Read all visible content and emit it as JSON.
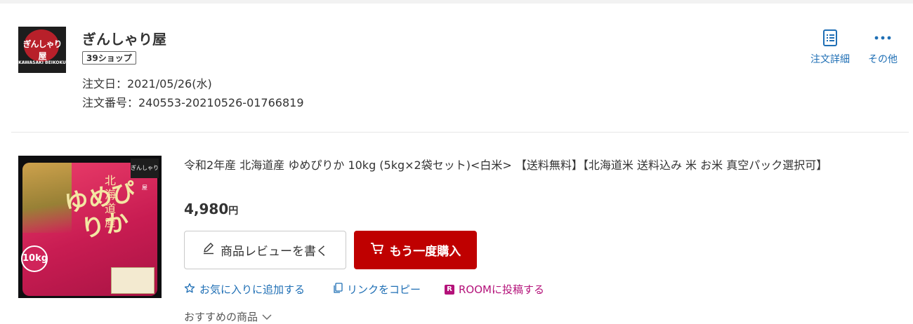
{
  "shop": {
    "name": "ぎんしゃり屋",
    "badge": "39ショップ",
    "logo_text": "ぎんしゃり屋",
    "logo_subtext": "KAWASAKI BEIKOKU",
    "order_date": "注文日：2021/05/26(水)",
    "order_number": "注文番号：240553-20210526-01766819"
  },
  "header_actions": {
    "detail_label": "注文詳細",
    "detail_icon": "document-list-icon",
    "more_label": "その他",
    "more_icon": "more-dots-icon"
  },
  "item": {
    "title": "令和2年産 北海道産 ゆめぴりか 10kg (5kg×2袋セット)<白米> 【送料無料】【北海道米 送料込み 米 お米 真空パック選択可】",
    "price": "4,980",
    "currency": "円",
    "image_text": {
      "brand": "ゆめぴりか",
      "region": "北海道産",
      "weight": "10kg",
      "shop": "ぎんしゃり屋"
    },
    "review_button": "商品レビューを書く",
    "rebuy_button": "もう一度購入",
    "links": {
      "favorite": "お気に入りに追加する",
      "copy": "リンクをコピー",
      "room": "ROOMに投稿する"
    },
    "recommend": "おすすめの商品"
  },
  "colors": {
    "accent_blue": "#1f6fb5",
    "rebuy_red": "#bf0000",
    "room_magenta": "#b4127a"
  }
}
